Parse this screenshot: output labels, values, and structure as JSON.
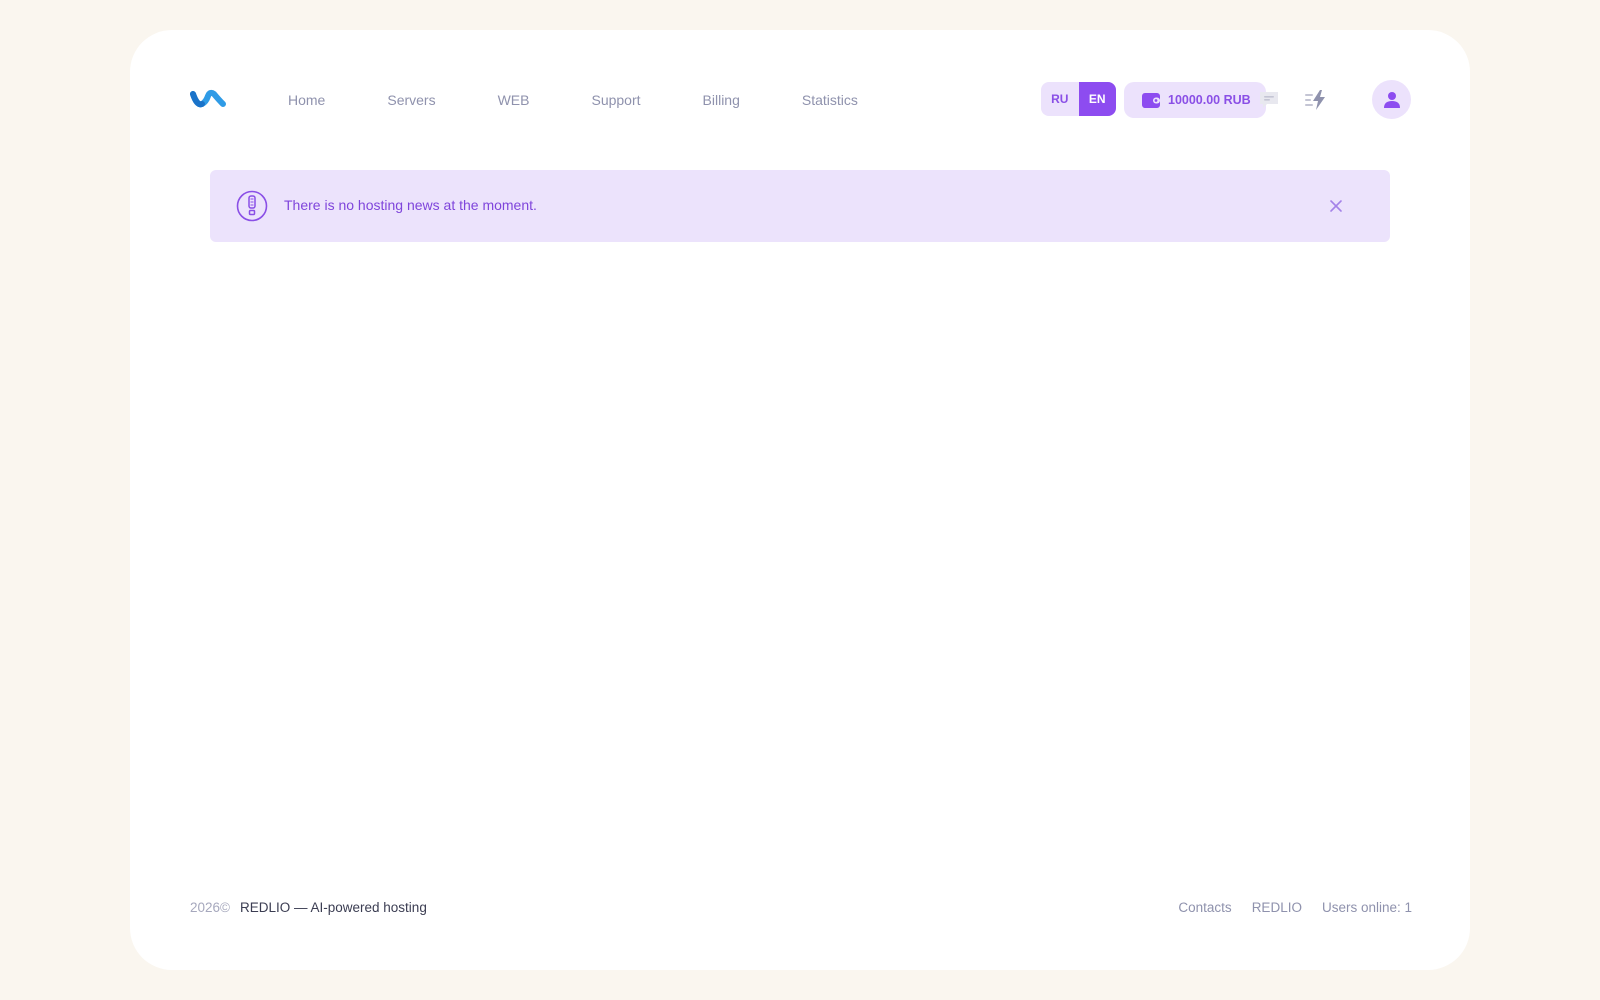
{
  "colors": {
    "accent": "#8d4cf0",
    "accent_light": "#ece2fc",
    "logo_blue": "#2f9be6"
  },
  "header": {
    "logo_icon": "brand-logo-icon",
    "nav": [
      {
        "label": "Home"
      },
      {
        "label": "Servers"
      },
      {
        "label": "WEB"
      },
      {
        "label": "Support"
      },
      {
        "label": "Billing"
      },
      {
        "label": "Statistics"
      }
    ],
    "language": {
      "options": [
        "RU",
        "EN"
      ],
      "selected": "EN"
    },
    "balance": {
      "icon": "wallet-icon",
      "amount": "10000.00 RUB"
    },
    "icons": [
      "chat-icon",
      "quick-actions-icon",
      "user-icon"
    ]
  },
  "alert": {
    "icon": "info-alert-icon",
    "message": "There is no hosting news at the moment.",
    "close_icon": "close-icon"
  },
  "footer": {
    "year": "2026©",
    "tagline": "REDLIO — AI-powered hosting",
    "links": [
      {
        "label": "Contacts"
      },
      {
        "label": "REDLIO"
      }
    ],
    "online": "Users online: 1"
  }
}
